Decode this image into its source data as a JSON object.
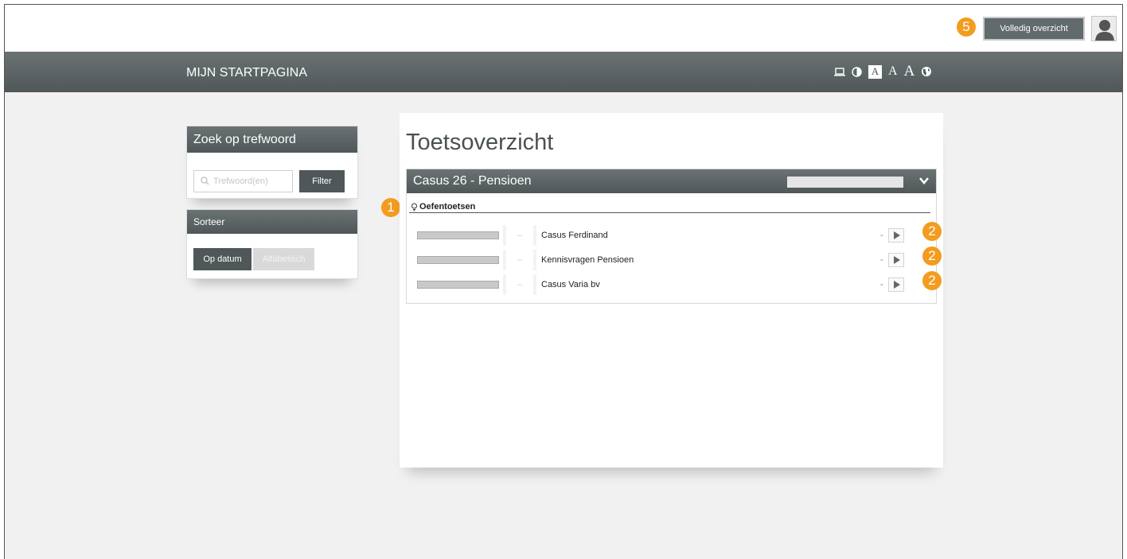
{
  "header": {
    "callout": "5",
    "full_overview_label": "Volledig overzicht"
  },
  "navbar": {
    "title": "MIJN STARTPAGINA",
    "tools": [
      "monitor-icon",
      "contrast-icon",
      "font-size-small",
      "font-size-medium",
      "font-size-large",
      "globe-icon"
    ],
    "font_label": "A"
  },
  "search": {
    "title": "Zoek op trefwoord",
    "placeholder": "Trefwoord(en)",
    "filter_label": "Filter"
  },
  "sort": {
    "title": "Sorteer",
    "by_date_label": "Op datum",
    "alphabetical_label": "Alfabetisch"
  },
  "main": {
    "title": "Toetsoverzicht",
    "casus_title": "Casus 26 - Pensioen",
    "section_callout": "1",
    "section_label": "Oefentoetsen",
    "tests": [
      {
        "dash": "–",
        "name": "Casus Ferdinand",
        "minus": "-",
        "callout": "2"
      },
      {
        "dash": "–",
        "name": "Kennisvragen Pensioen",
        "minus": "-",
        "callout": "2"
      },
      {
        "dash": "–",
        "name": "Casus Varia bv",
        "minus": "-",
        "callout": "2"
      }
    ]
  },
  "colors": {
    "accent_orange": "#f39c1f",
    "header_gray": "#4f5759",
    "background": "#f1f1f1"
  }
}
